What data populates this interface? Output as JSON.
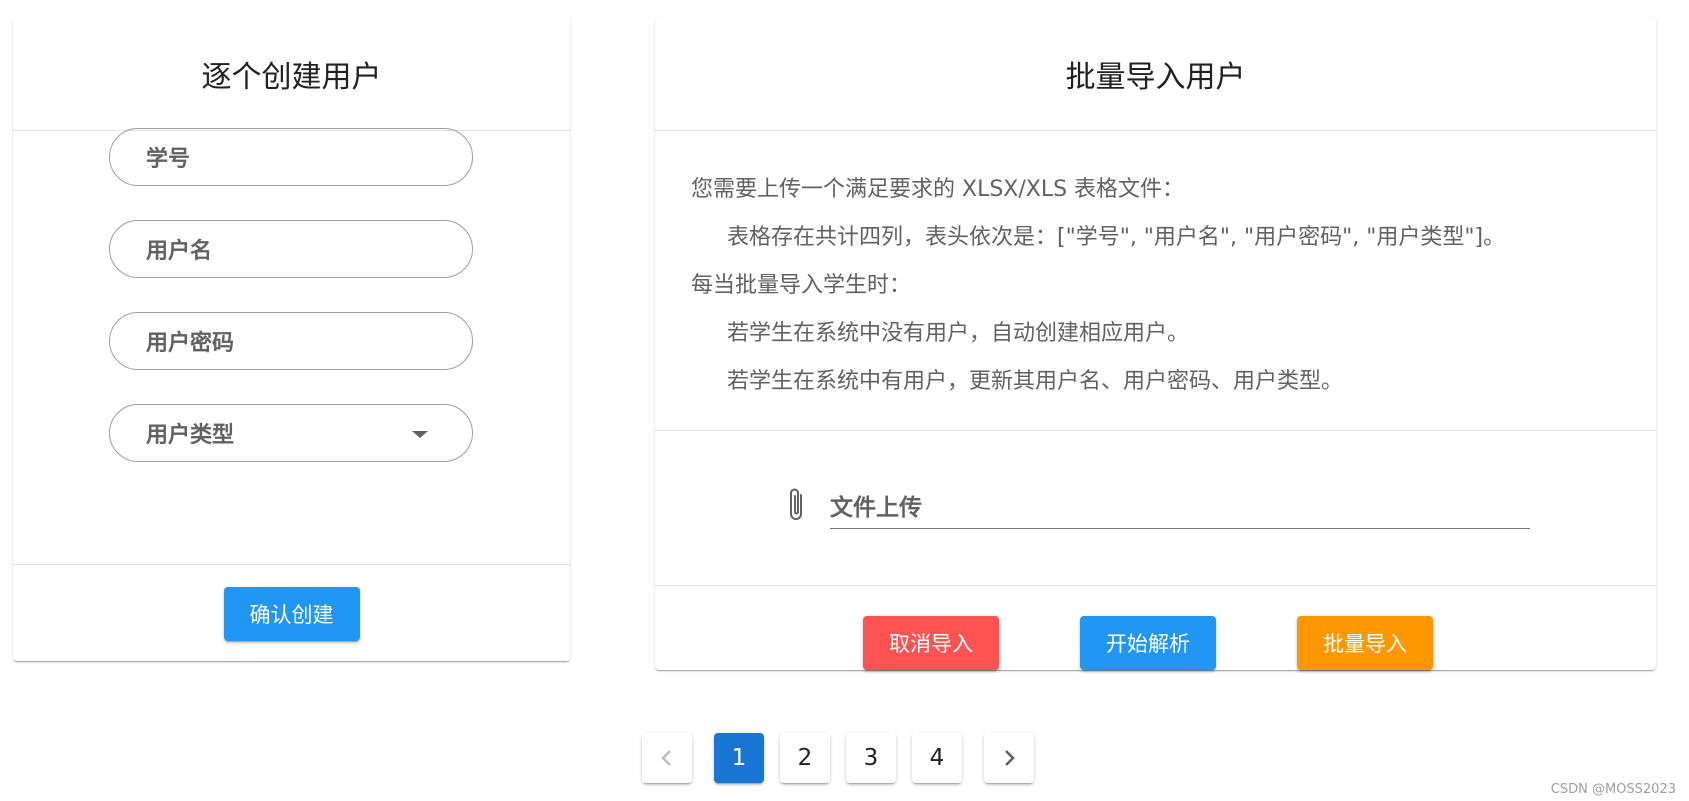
{
  "create_card": {
    "title": "逐个创建用户",
    "fields": {
      "student_id": "学号",
      "username": "用户名",
      "password": "用户密码",
      "user_type": "用户类型"
    },
    "confirm_label": "确认创建"
  },
  "import_card": {
    "title": "批量导入用户",
    "instructions": [
      "您需要上传一个满足要求的 XLSX/XLS 表格文件：",
      "表格存在共计四列，表头依次是：[\"学号\", \"用户名\", \"用户密码\", \"用户类型\"]。",
      "每当批量导入学生时：",
      "若学生在系统中没有用户，自动创建相应用户。",
      "若学生在系统中有用户，更新其用户名、用户密码、用户类型。"
    ],
    "upload_label": "文件上传",
    "cancel_label": "取消导入",
    "parse_label": "开始解析",
    "import_label": "批量导入"
  },
  "pagination": {
    "pages": [
      "1",
      "2",
      "3",
      "4"
    ],
    "current": "1"
  },
  "watermark": "CSDN @MOSS2023",
  "colors": {
    "primary": "#2196f3",
    "active_page": "#1976d2",
    "danger": "#ff5252",
    "warning": "#ff9800"
  }
}
